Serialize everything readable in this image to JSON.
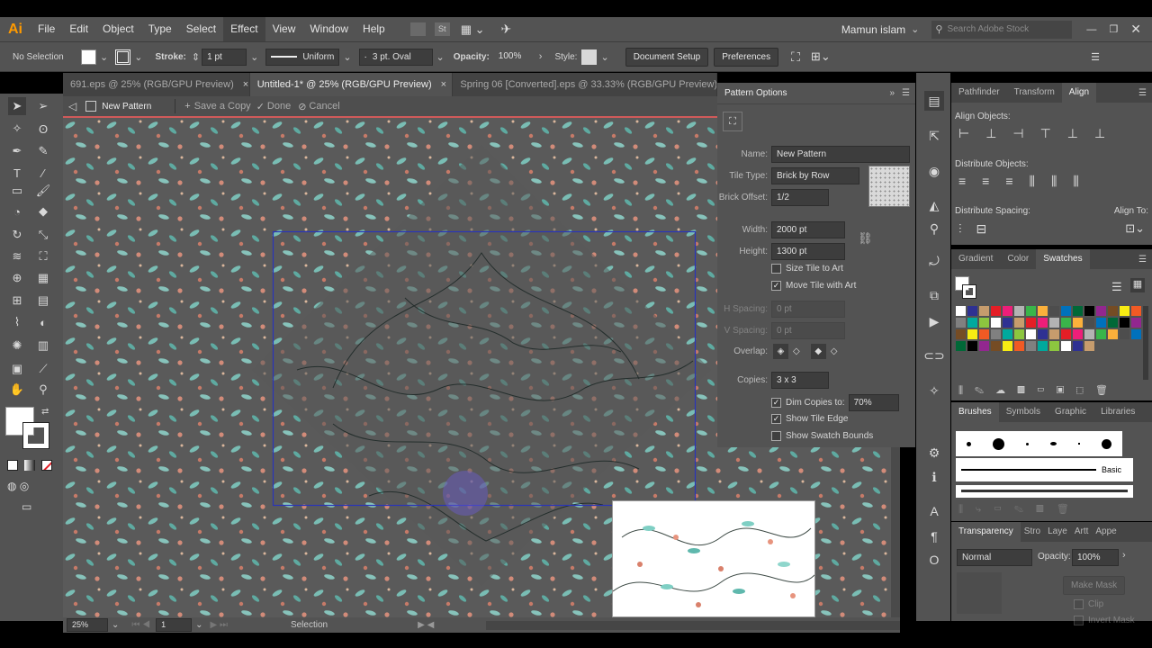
{
  "app": {
    "logo": "Ai",
    "user": "Mamun islam",
    "search_placeholder": "Search Adobe Stock",
    "stock_badge": "St"
  },
  "menu": [
    "File",
    "Edit",
    "Object",
    "Type",
    "Select",
    "Effect",
    "View",
    "Window",
    "Help"
  ],
  "control": {
    "selection": "No Selection",
    "stroke_label": "Stroke:",
    "stroke_value": "1 pt",
    "profile": "Uniform",
    "brush": "3 pt. Oval",
    "opacity_label": "Opacity:",
    "opacity_value": "100%",
    "style_label": "Style:",
    "doc_setup": "Document Setup",
    "preferences": "Preferences"
  },
  "tabs": [
    {
      "label": "691.eps @ 25% (RGB/GPU Preview)"
    },
    {
      "label": "Untitled-1* @ 25% (RGB/GPU Preview)"
    },
    {
      "label": "Spring 06 [Converted].eps @ 33.33% (RGB/GPU Preview)"
    }
  ],
  "tab_close": "×",
  "isolation": {
    "name": "New Pattern",
    "save_copy": "Save a Copy",
    "done": "Done",
    "cancel": "Cancel"
  },
  "pattern_options": {
    "title": "Pattern Options",
    "name_label": "Name:",
    "name_value": "New Pattern",
    "tile_type_label": "Tile Type:",
    "tile_type": "Brick by Row",
    "brick_offset_label": "Brick Offset:",
    "brick_offset": "1/2",
    "width_label": "Width:",
    "width": "2000 pt",
    "height_label": "Height:",
    "height": "1300 pt",
    "size_tile": "Size Tile to Art",
    "move_tile": "Move Tile with Art",
    "h_spacing_label": "H Spacing:",
    "h_spacing": "0 pt",
    "v_spacing_label": "V Spacing:",
    "v_spacing": "0 pt",
    "overlap_label": "Overlap:",
    "copies_label": "Copies:",
    "copies": "3 x 3",
    "dim_copies": "Dim Copies to:",
    "dim_value": "70%",
    "show_tile_edge": "Show Tile Edge",
    "show_swatch_bounds": "Show Swatch Bounds"
  },
  "align_panel": {
    "tabs": [
      "Pathfinder",
      "Transform",
      "Align"
    ],
    "align_objects": "Align Objects:",
    "distribute_objects": "Distribute Objects:",
    "distribute_spacing": "Distribute Spacing:",
    "align_to": "Align To:"
  },
  "swatch_panel": {
    "tabs": [
      "Gradient",
      "Color",
      "Swatches"
    ],
    "colors": [
      "#ffffff",
      "#000000",
      "#e41e26",
      "#f7ec13",
      "#39b54a",
      "#00a99d",
      "#0071bc",
      "#2e3192",
      "#92278f",
      "#ed1e79",
      "#f15a24",
      "#fbb03b",
      "#8cc63f",
      "#006837",
      "#c69c6d",
      "#754c24",
      "#b3b3b3",
      "#808080",
      "#4d4d4d"
    ]
  },
  "brushes_panel": {
    "tabs": [
      "Brushes",
      "Symbols",
      "Graphic",
      "Libraries"
    ],
    "basic": "Basic"
  },
  "transparency_panel": {
    "tabs": [
      "Transparency",
      "Stro",
      "Laye",
      "Artt",
      "Appe"
    ],
    "mode": "Normal",
    "opacity_label": "Opacity:",
    "opacity_value": "100%",
    "make_mask": "Make Mask",
    "clip": "Clip",
    "invert_mask": "Invert Mask"
  },
  "status": {
    "zoom": "25%",
    "artboard": "1",
    "tool": "Selection"
  }
}
